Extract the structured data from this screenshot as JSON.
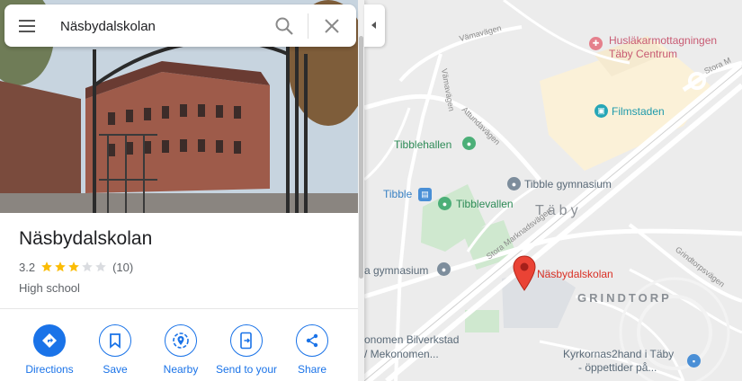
{
  "search": {
    "value": "Näsbydalskolan"
  },
  "place": {
    "title": "Näsbydalskolan",
    "rating": "3.2",
    "rating_stars": 3,
    "review_count": "(10)",
    "category": "High school"
  },
  "actions": [
    {
      "label": "Directions",
      "icon": "directions-icon"
    },
    {
      "label": "Save",
      "icon": "bookmark-icon"
    },
    {
      "label": "Nearby",
      "icon": "nearby-icon"
    },
    {
      "label": "Send to your",
      "icon": "send-to-phone-icon"
    },
    {
      "label": "Share",
      "icon": "share-icon"
    }
  ],
  "map": {
    "pois": {
      "huslakar": "Husläkarmottagningen",
      "huslakar2": "Täby Centrum",
      "filmstaden": "Filmstaden",
      "tibblehallen": "Tibblehallen",
      "tibble_gymnasium": "Tibble gymnasium",
      "tibble_station": "Tibble",
      "tibblevallen": "Tibblevallen",
      "aby_gymnasium": "a gymnasium",
      "selected": "Näsbydalskolan",
      "bilverkstad1": "onomen Bilverkstad",
      "bilverkstad2": "/ Mekonomen...",
      "kyrkornas1": "Kyrkornas2hand i Täby",
      "kyrkornas2": "- öppettider på..."
    },
    "areas": {
      "taby": "Täby",
      "grindtorp": "GRINDTORP"
    },
    "roads": {
      "attundavagen": "Attundavägen",
      "vamavagen": "Vämavägen",
      "stora_mark": "Stora Marknadsvägen",
      "stora_mark2": "Stora M",
      "grindtorpsvagen": "Grindtorpsvägen",
      "top_vagen": "Vämavägen"
    }
  },
  "colors": {
    "accent": "#1a73e8",
    "star": "#fbbc04",
    "pin": "#ea4335"
  }
}
